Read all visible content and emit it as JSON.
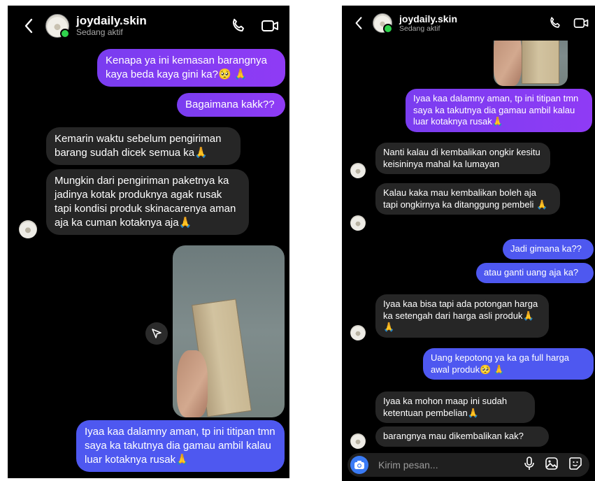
{
  "chat": {
    "username": "joydaily.skin",
    "status": "Sedang aktif"
  },
  "left": {
    "messages": [
      {
        "text": "Kenapa ya ini kemasan barangnya kaya beda kaya gini ka?🥺 🙏"
      },
      {
        "text": "Bagaimana kakk??"
      },
      {
        "text": "Kemarin waktu sebelum pengiriman barang sudah dicek semua ka🙏"
      },
      {
        "text": "Mungkin dari pengiriman paketnya ka jadinya kotak produknya agak rusak tapi kondisi produk skinacarenya aman aja ka cuman kotaknya aja🙏"
      },
      {
        "text": "Iyaa kaa dalamny aman, tp ini titipan tmn saya ka takutnya dia gamau ambil kalau luar kotaknya rusak🙏"
      }
    ]
  },
  "right": {
    "messages": [
      {
        "text": "Iyaa kaa dalamny aman, tp ini titipan tmn saya ka takutnya dia gamau ambil kalau luar kotaknya rusak🙏"
      },
      {
        "text": "Nanti kalau di kembalikan ongkir kesitu keisininya mahal ka lumayan"
      },
      {
        "text": "Kalau kaka mau kembalikan boleh aja tapi ongkirnya ka ditanggung pembeli 🙏"
      },
      {
        "text": "Jadi gimana ka??"
      },
      {
        "text": "atau ganti uang aja ka?"
      },
      {
        "text": "Iyaa kaa bisa tapi ada potongan harga ka setengah dari harga asli produk🙏 🙏"
      },
      {
        "text": "Uang kepotong ya ka ga full harga awal produk🥺 🙏"
      },
      {
        "text": "Iyaa ka mohon maap ini sudah ketentuan pembelian🙏"
      },
      {
        "text": "barangnya mau dikembalikan kak?"
      }
    ],
    "composer_placeholder": "Kirim pesan..."
  },
  "icons": {
    "back": "chevron-left-icon",
    "call": "phone-icon",
    "video": "video-camera-icon",
    "share": "send-icon",
    "camera": "camera-icon",
    "mic": "microphone-icon",
    "gallery": "image-icon",
    "sticker": "sticker-icon"
  },
  "colors": {
    "outgoing_purple": "#8a3cf2",
    "outgoing_blue": "#4e58f0",
    "incoming": "#262626",
    "online": "#2fd34c",
    "camera_button": "#3a7bf5"
  }
}
